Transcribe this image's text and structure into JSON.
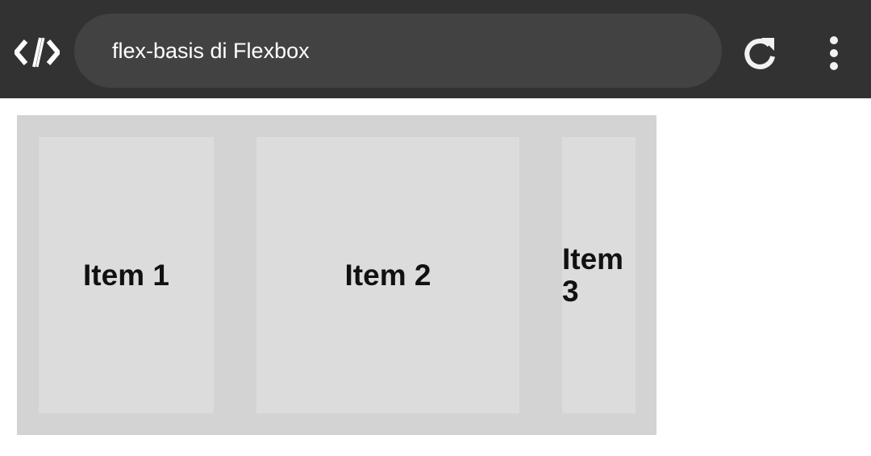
{
  "browser": {
    "logo_icon": "code-brackets-logo-icon",
    "url_text": "flex-basis di Flexbox",
    "reload_icon": "reload-icon",
    "menu_icon": "more-vert-icon"
  },
  "colors": {
    "toolbar_bg": "#323232",
    "urlbar_bg": "#424242",
    "container_bg": "#d3d3d3",
    "item_bg": "#dcdcdc"
  },
  "flex_container": {
    "items": [
      {
        "label": "Item 1"
      },
      {
        "label": "Item 2"
      },
      {
        "label": "Item 3"
      }
    ]
  }
}
